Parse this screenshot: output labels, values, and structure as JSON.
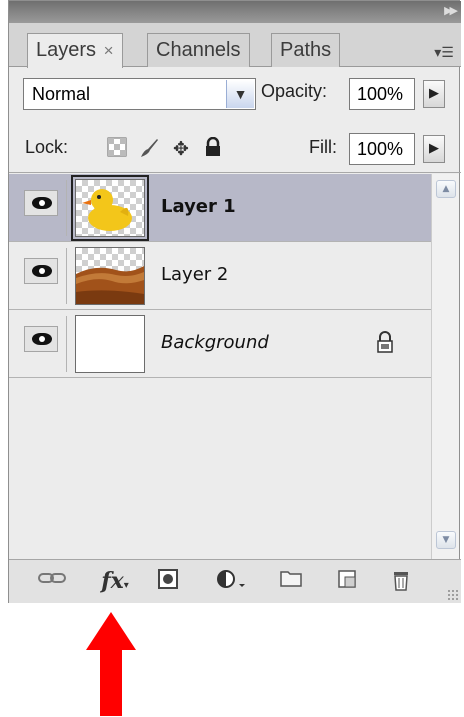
{
  "tabs": [
    {
      "label": "Layers",
      "close": "×"
    },
    {
      "label": "Channels"
    },
    {
      "label": "Paths"
    }
  ],
  "blend_mode": {
    "value": "Normal"
  },
  "opacity": {
    "label": "Opacity:",
    "value": "100%"
  },
  "lock": {
    "label": "Lock:"
  },
  "fill": {
    "label": "Fill:",
    "value": "100%"
  },
  "layers": [
    {
      "name": "Layer 1",
      "selected": true
    },
    {
      "name": "Layer 2",
      "selected": false
    },
    {
      "name": "Background",
      "selected": false,
      "locked": true
    }
  ],
  "bottom_toolbar": {
    "fx_label": "fx"
  },
  "colors": {
    "selected_row": "#b7b8c8",
    "annotation_arrow": "#ff0000"
  }
}
